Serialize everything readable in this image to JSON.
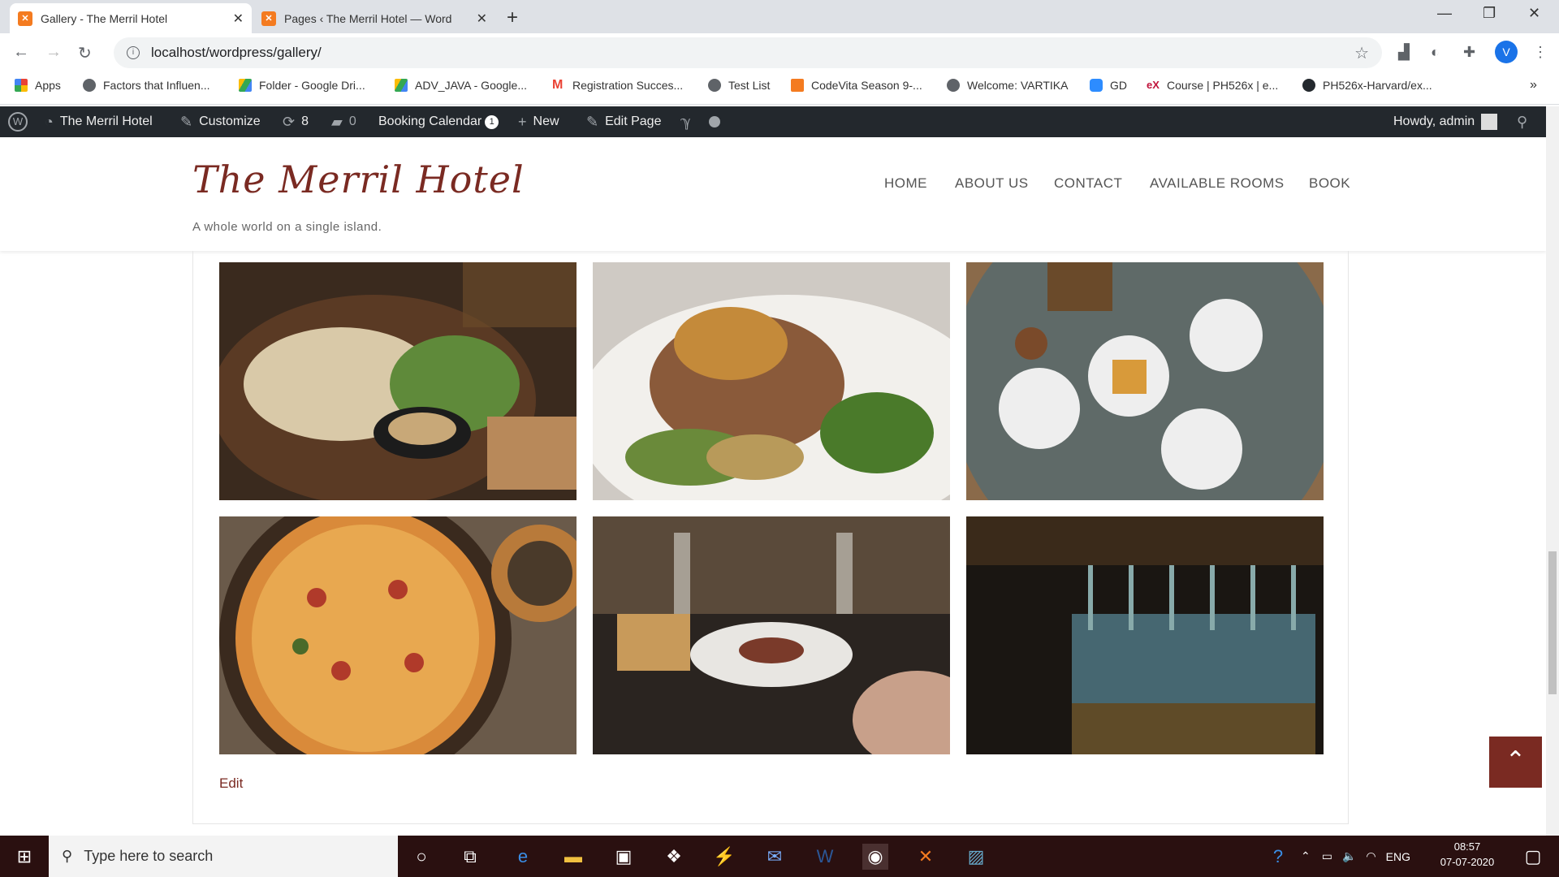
{
  "browser": {
    "tabs": [
      {
        "title": "Gallery - The Merril Hotel",
        "active": true
      },
      {
        "title": "Pages ‹ The Merril Hotel — Word",
        "active": false
      }
    ],
    "url": "localhost/wordpress/gallery/",
    "profile_initial": "V",
    "bookmarks": [
      {
        "label": "Apps",
        "icon": "apps-grid-icon"
      },
      {
        "label": "Factors that Influen...",
        "icon": "globe-icon"
      },
      {
        "label": "Folder - Google Dri...",
        "icon": "google-drive-icon"
      },
      {
        "label": "ADV_JAVA - Google...",
        "icon": "google-drive-icon"
      },
      {
        "label": "Registration Succes...",
        "icon": "gmail-icon"
      },
      {
        "label": "Test List",
        "icon": "globe-icon"
      },
      {
        "label": "CodeVita Season 9-...",
        "icon": "codevita-icon"
      },
      {
        "label": "Welcome: VARTIKA",
        "icon": "globe-icon"
      },
      {
        "label": "GD",
        "icon": "zoom-icon"
      },
      {
        "label": "Course | PH526x | e...",
        "icon": "edx-icon"
      },
      {
        "label": "PH526x-Harvard/ex...",
        "icon": "github-icon"
      }
    ]
  },
  "wp_admin_bar": {
    "site_name": "The Merril Hotel",
    "customize": "Customize",
    "updates_count": "8",
    "comments_count": "0",
    "booking_calendar": "Booking Calendar",
    "booking_badge": "1",
    "new": "New",
    "edit_page": "Edit Page",
    "howdy": "Howdy, admin"
  },
  "site": {
    "title": "The Merril Hotel",
    "tagline": "A whole world on a single island.",
    "nav": [
      "HOME",
      "ABOUT US",
      "CONTACT",
      "AVAILABLE ROOMS",
      "BOOK"
    ]
  },
  "gallery": [
    {
      "name": "grilled-seafood-platter"
    },
    {
      "name": "grilled-pork-chop"
    },
    {
      "name": "brunch-table-top-view"
    },
    {
      "name": "pepperoni-pizza"
    },
    {
      "name": "restaurant-dining-table"
    },
    {
      "name": "hanging-wine-glasses"
    }
  ],
  "edit_link": "Edit",
  "taskbar": {
    "search_placeholder": "Type here to search",
    "language": "ENG",
    "time": "08:57",
    "date": "07-07-2020"
  },
  "colors": {
    "brand": "#7a2a22",
    "admin_bar": "#23282d",
    "taskbar": "#2a1010"
  }
}
